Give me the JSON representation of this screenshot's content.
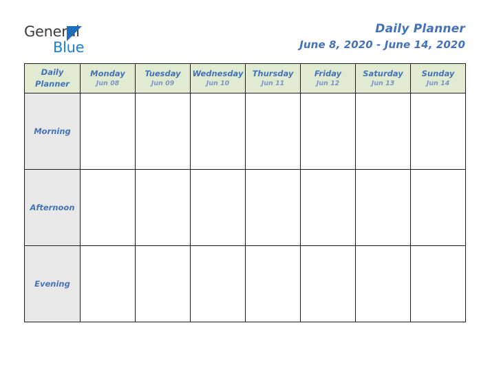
{
  "brand": {
    "name_part1": "General",
    "name_part2": "Blue",
    "triangle_icon": "triangle-icon",
    "colors": {
      "general_text": "#3c3c3c",
      "blue_text": "#1e7fd0",
      "triangle": "#1e6fbb"
    }
  },
  "header": {
    "title": "Daily Planner",
    "date_range": "June 8, 2020 - June 14, 2020",
    "title_color": "#4472b8"
  },
  "table": {
    "corner": {
      "line1": "Daily",
      "line2": "Planner"
    },
    "header_background": "#e0ebd2",
    "row_label_background": "#e8e8e8",
    "cell_background": "#fdfdfd",
    "border_color": "#1a1a1a",
    "days": [
      {
        "name": "Monday",
        "date": "Jun 08"
      },
      {
        "name": "Tuesday",
        "date": "Jun 09"
      },
      {
        "name": "Wednesday",
        "date": "Jun 10"
      },
      {
        "name": "Thursday",
        "date": "Jun 11"
      },
      {
        "name": "Friday",
        "date": "Jun 12"
      },
      {
        "name": "Saturday",
        "date": "Jun 13"
      },
      {
        "name": "Sunday",
        "date": "Jun 14"
      }
    ],
    "rows": [
      {
        "label": "Morning",
        "entries": [
          "",
          "",
          "",
          "",
          "",
          "",
          ""
        ]
      },
      {
        "label": "Afternoon",
        "entries": [
          "",
          "",
          "",
          "",
          "",
          "",
          ""
        ]
      },
      {
        "label": "Evening",
        "entries": [
          "",
          "",
          "",
          "",
          "",
          "",
          ""
        ]
      }
    ]
  }
}
